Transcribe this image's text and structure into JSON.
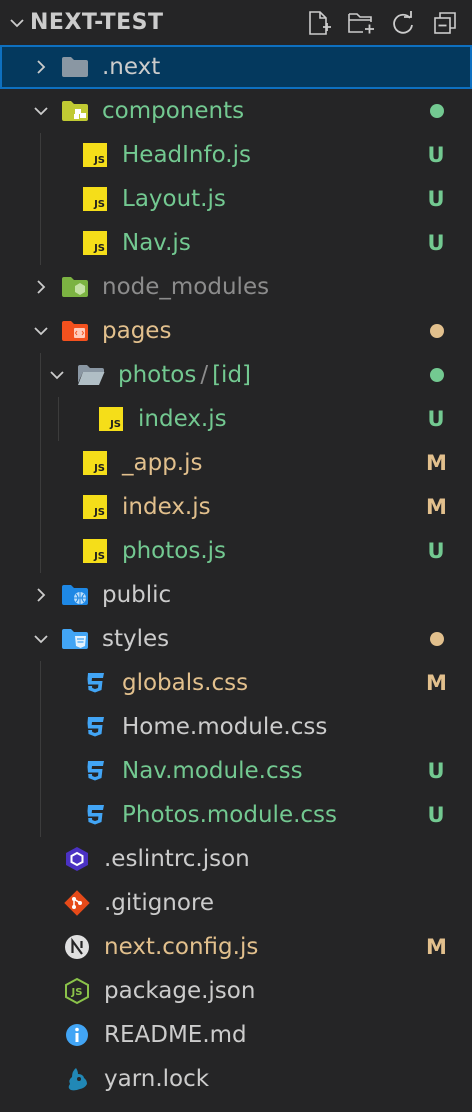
{
  "explorer": {
    "title": "NEXT-TEST",
    "actions": [
      "new-file-icon",
      "new-folder-icon",
      "refresh-icon",
      "collapse-all-icon"
    ]
  },
  "colors": {
    "untracked": "#73c991",
    "modified": "#e2c08d",
    "ignored": "#8c8c8c",
    "selection_bg": "#04395e",
    "selection_border": "#0e70c0"
  },
  "tree": [
    {
      "label": ".next",
      "status": "",
      "dot": ""
    },
    {
      "label": "components",
      "status": "",
      "dot": "green"
    },
    {
      "label": "HeadInfo.js",
      "status": "U"
    },
    {
      "label": "Layout.js",
      "status": "U"
    },
    {
      "label": "Nav.js",
      "status": "U"
    },
    {
      "label": "node_modules",
      "status": ""
    },
    {
      "label": "pages",
      "status": "",
      "dot": "yellow"
    },
    {
      "label_a": "photos",
      "sep": "/",
      "label_b": "[id]",
      "status": "",
      "dot": "green"
    },
    {
      "label": "index.js",
      "status": "U"
    },
    {
      "label": "_app.js",
      "status": "M"
    },
    {
      "label": "index.js",
      "status": "M"
    },
    {
      "label": "photos.js",
      "status": "U"
    },
    {
      "label": "public",
      "status": ""
    },
    {
      "label": "styles",
      "status": "",
      "dot": "yellow"
    },
    {
      "label": "globals.css",
      "status": "M"
    },
    {
      "label": "Home.module.css",
      "status": ""
    },
    {
      "label": "Nav.module.css",
      "status": "U"
    },
    {
      "label": "Photos.module.css",
      "status": "U"
    },
    {
      "label": ".eslintrc.json",
      "status": ""
    },
    {
      "label": ".gitignore",
      "status": ""
    },
    {
      "label": "next.config.js",
      "status": "M"
    },
    {
      "label": "package.json",
      "status": ""
    },
    {
      "label": "README.md",
      "status": ""
    },
    {
      "label": "yarn.lock",
      "status": ""
    }
  ]
}
